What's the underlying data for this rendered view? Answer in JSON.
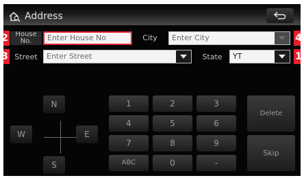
{
  "header": {
    "title": "Address",
    "home_icon": "home-search-icon",
    "back_icon": "back-arrow-icon"
  },
  "tags": {
    "house_no": "2",
    "street": "3",
    "city": "4",
    "state": "1"
  },
  "colors": {
    "tag_red": "#e8202c",
    "screen_bg": "#050505",
    "field_bg": "#f4f4f4"
  },
  "form": {
    "house_no": {
      "label_line1": "House",
      "label_line2": "No.",
      "placeholder": "Enter House No"
    },
    "city": {
      "label": "City",
      "placeholder": "Enter City"
    },
    "street": {
      "label": "Street",
      "placeholder": "Enter Street"
    },
    "state": {
      "label": "State",
      "value": "YT"
    }
  },
  "keypad": {
    "directions": {
      "north": "N",
      "south": "S",
      "west": "W",
      "east": "E"
    },
    "digits": [
      "1",
      "2",
      "3",
      "4",
      "5",
      "6",
      "7",
      "8",
      "9"
    ],
    "abc": "ABC",
    "zero": "0",
    "dash": "-",
    "delete": "Delete",
    "skip": "Skip"
  }
}
